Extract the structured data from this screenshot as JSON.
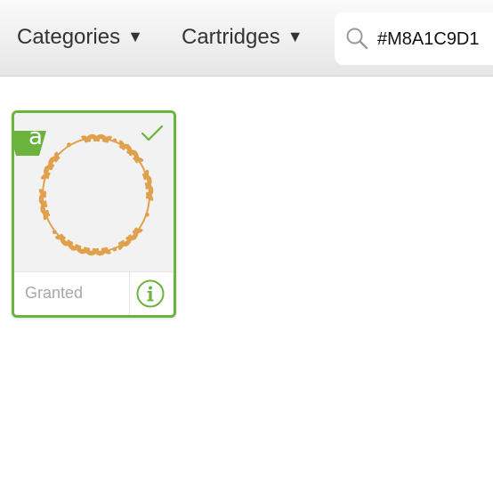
{
  "header": {
    "nav": [
      {
        "label": "Categories",
        "caret": "▼"
      },
      {
        "label": "Cartridges",
        "caret": "▼"
      }
    ],
    "search": {
      "value": "#M8A1C9D1",
      "icon": "search-icon"
    }
  },
  "results": {
    "items": [
      {
        "status": "Granted",
        "access_badge": "a",
        "selected": true,
        "image": "leaf-wreath",
        "image_color": "#e0a04c",
        "icons": [
          "access-badge-icon",
          "checkmark-icon",
          "info-icon"
        ]
      }
    ]
  },
  "colors": {
    "accent": "#6ab43e",
    "image_bg": "#f2f2f2",
    "status_text": "#a8a8a8"
  }
}
